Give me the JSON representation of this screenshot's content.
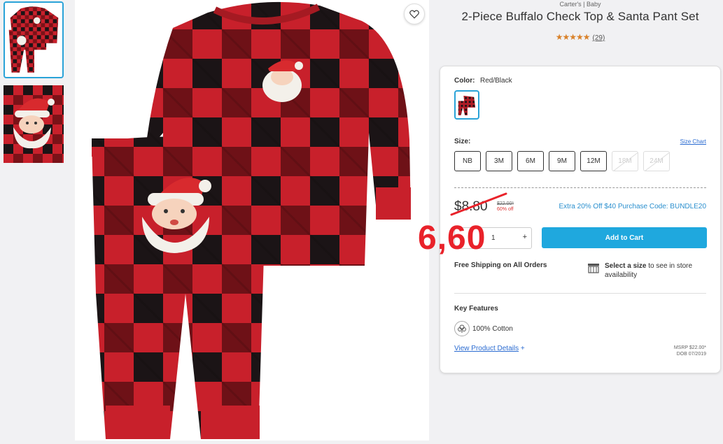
{
  "product": {
    "brand": "Carter's | Baby",
    "title": "2-Piece Buffalo Check Top & Santa Pant Set",
    "stars": "★★★★★",
    "review_count": "(29)"
  },
  "card": {
    "color_label": "Color:",
    "color_value": "Red/Black",
    "size_label": "Size:",
    "size_chart": "Size Chart",
    "sizes": [
      {
        "label": "NB",
        "available": true
      },
      {
        "label": "3M",
        "available": true
      },
      {
        "label": "6M",
        "available": true
      },
      {
        "label": "9M",
        "available": true
      },
      {
        "label": "12M",
        "available": true
      },
      {
        "label": "18M",
        "available": false
      },
      {
        "label": "24M",
        "available": false
      }
    ],
    "price": "$8.80",
    "was_price": "$22.00*",
    "percent_off": "60% off",
    "promo": "Extra 20% Off $40 Purchase Code: BUNDLE20",
    "annotation": "6,60",
    "quantity": "1",
    "qty_plus": "+",
    "add_to_cart": "Add to Cart",
    "free_shipping": "Free Shipping on All Orders",
    "store_bold": "Select a size",
    "store_rest": " to see in store availability",
    "key_features": "Key Features",
    "cotton": "100% Cotton",
    "view_details": "View Product Details",
    "view_details_plus": "+",
    "msrp": "MSRP $22.00*",
    "dob": "DOB 07/2019"
  },
  "colors": {
    "accent": "#1fa8de",
    "link": "#2a6bd1",
    "annotation": "#e9222a",
    "plaid_red": "#c8202b",
    "plaid_black": "#1b1416",
    "star": "#d9822b"
  },
  "icons": {
    "favorite": "heart-icon",
    "store": "store-icon",
    "fabric": "cotton-icon"
  }
}
